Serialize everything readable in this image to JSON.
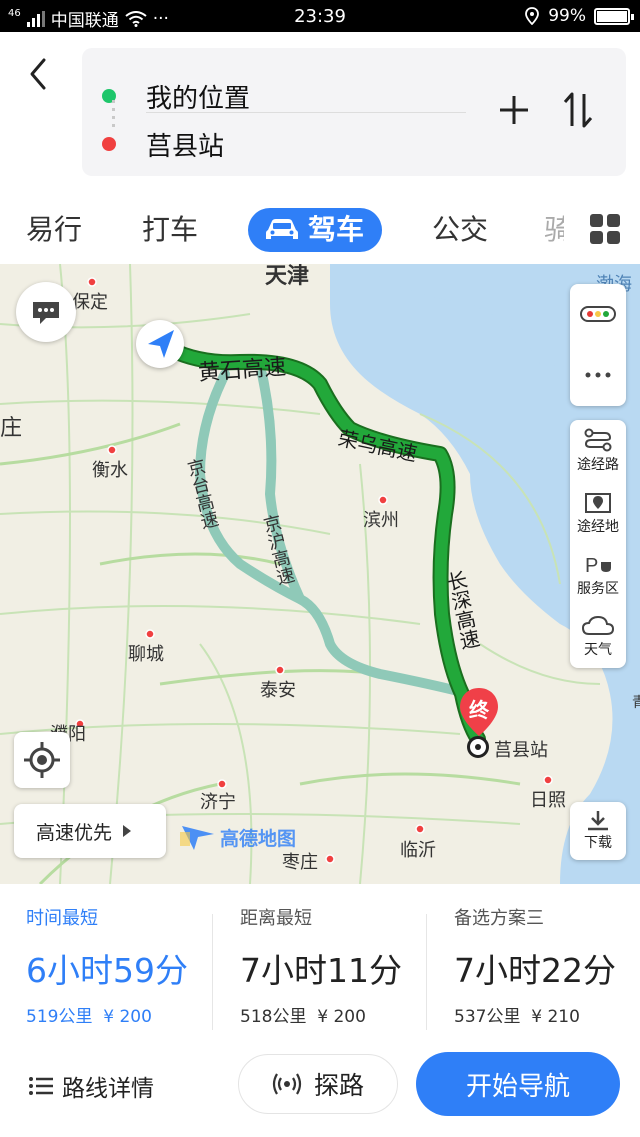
{
  "status_bar": {
    "carrier_signal": "46",
    "carrier": "中国联通",
    "more": "···",
    "time": "23:39",
    "battery": "99%",
    "battery_level": 0.99
  },
  "route": {
    "start": "我的位置",
    "end": "莒县站",
    "start_color": "#1ec66b",
    "end_color": "#f04040"
  },
  "tabs": [
    {
      "label": "易行",
      "active": false
    },
    {
      "label": "打车",
      "active": false
    },
    {
      "label": "驾车",
      "active": true,
      "icon": "car-icon"
    },
    {
      "label": "公交",
      "active": false
    },
    {
      "label": "骑",
      "active": false
    }
  ],
  "map": {
    "cities": [
      {
        "name": "天津"
      },
      {
        "name": "保定"
      },
      {
        "name": "衡水"
      },
      {
        "name": "滨州"
      },
      {
        "name": "聊城"
      },
      {
        "name": "泰安"
      },
      {
        "name": "濮阳"
      },
      {
        "name": "济宁"
      },
      {
        "name": "日照"
      },
      {
        "name": "临沂"
      },
      {
        "name": "枣庄"
      },
      {
        "name": "渤海"
      },
      {
        "name": "庄"
      },
      {
        "name": "青"
      }
    ],
    "roads": [
      {
        "name": "黄石高速"
      },
      {
        "name": "荣乌高速"
      },
      {
        "name": "长深高速"
      },
      {
        "name": "京台高速"
      },
      {
        "name": "京沪高速"
      }
    ],
    "destination_marker": "终",
    "destination_label": "莒县站",
    "route_color": "#22a83a",
    "alt_route_color": "#8fc9b8",
    "side_tools": [
      {
        "label": "途经路",
        "icon": "route-via-icon"
      },
      {
        "label": "途经地",
        "icon": "map-pin-icon"
      },
      {
        "label": "服务区",
        "icon": "service-area-icon"
      },
      {
        "label": "天气",
        "icon": "cloud-icon"
      }
    ],
    "priority_button": "高速优先",
    "download_button": "下载",
    "brand": "高德地图"
  },
  "options": [
    {
      "title": "时间最短",
      "time": "6小时59分",
      "distance": "519公里",
      "cost": "¥ 200",
      "active": true
    },
    {
      "title": "距离最短",
      "time": "7小时11分",
      "distance": "518公里",
      "cost": "¥ 200",
      "active": false
    },
    {
      "title": "备选方案三",
      "time": "7小时22分",
      "distance": "537公里",
      "cost": "¥ 210",
      "active": false
    }
  ],
  "actions": {
    "details": "路线详情",
    "probe": "探路",
    "start": "开始导航"
  },
  "accent": "#2f7ff7"
}
